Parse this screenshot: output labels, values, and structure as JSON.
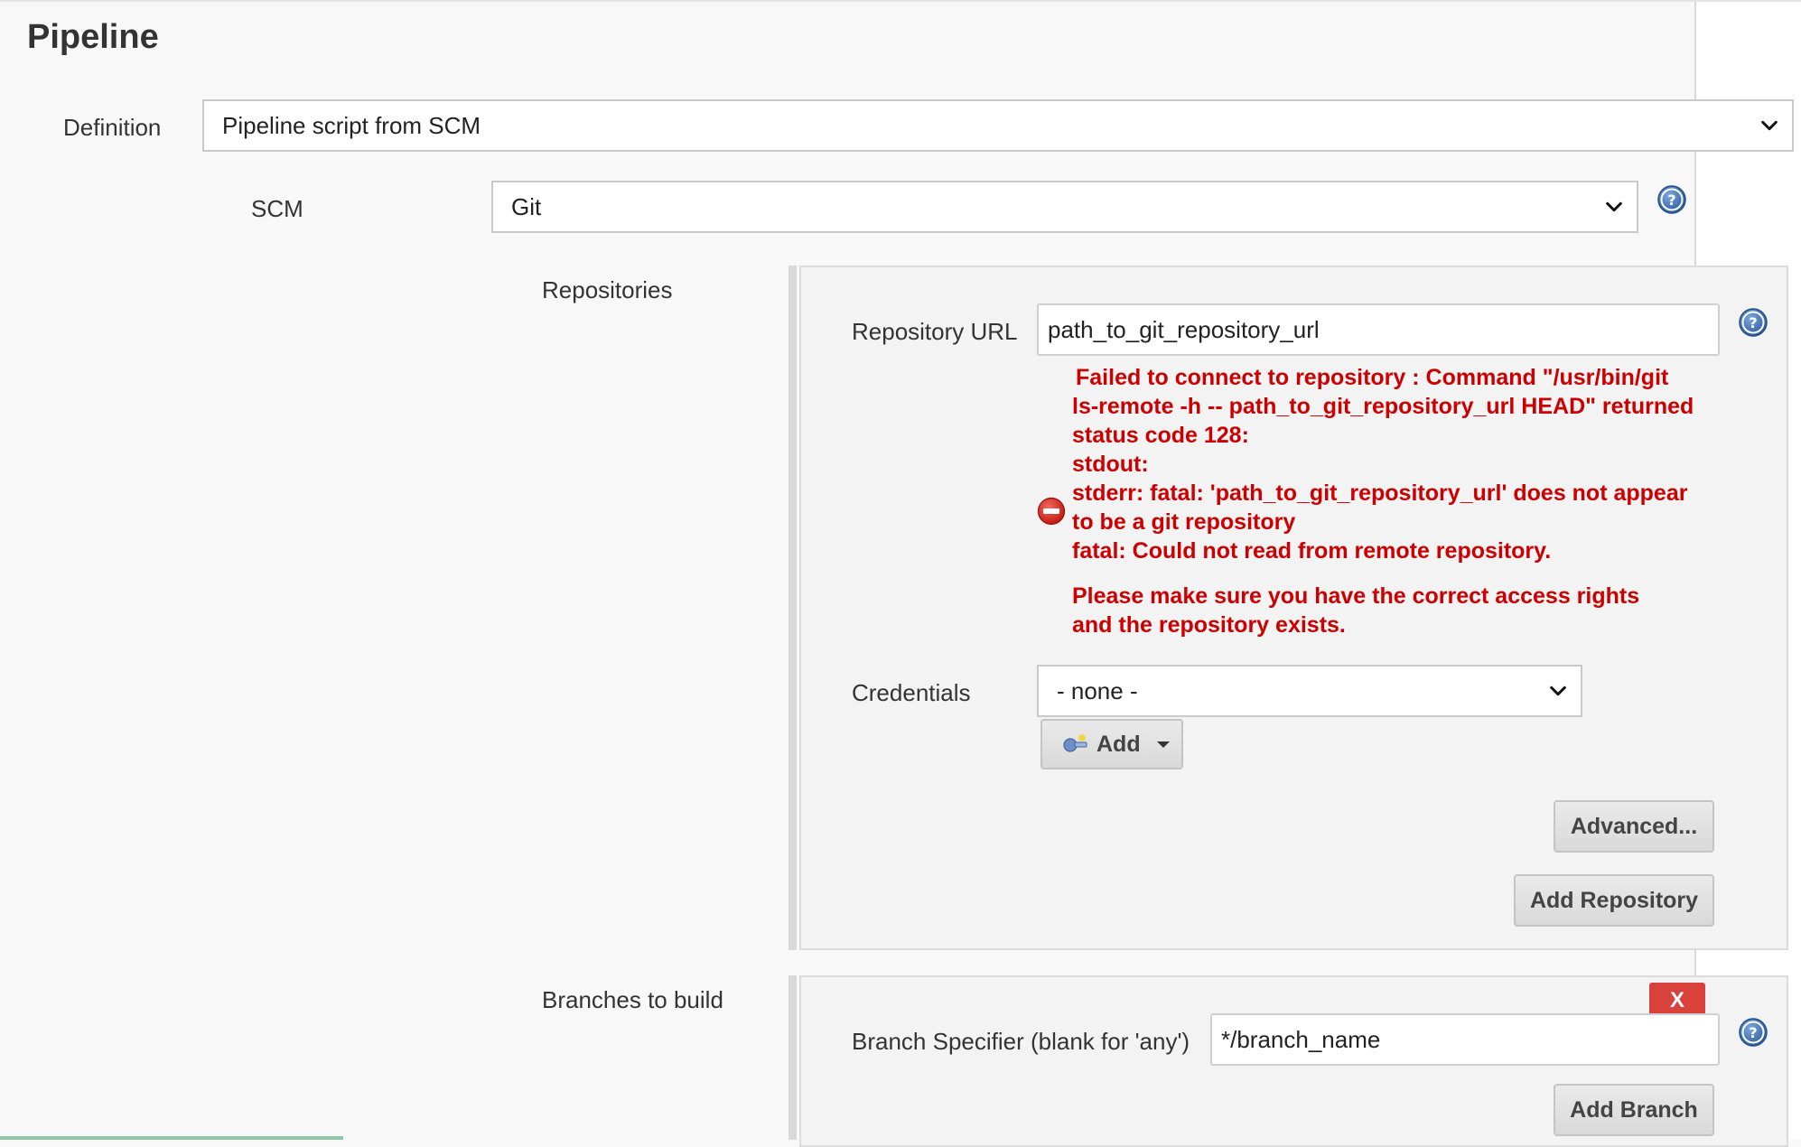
{
  "section": {
    "title": "Pipeline"
  },
  "definition": {
    "label": "Definition",
    "value": "Pipeline script from SCM"
  },
  "scm": {
    "label": "SCM",
    "value": "Git"
  },
  "repositories": {
    "label": "Repositories",
    "url_label": "Repository URL",
    "url_value": "path_to_git_repository_url",
    "error_lines": [
      "Failed to connect to repository : Command \"/usr/bin/git",
      "ls-remote -h -- path_to_git_repository_url HEAD\" returned",
      "status code 128:",
      "stdout:",
      "stderr: fatal: 'path_to_git_repository_url' does not appear",
      "to be a git repository",
      "fatal: Could not read from remote repository.",
      "Please make sure you have the correct access rights",
      "and the repository exists."
    ],
    "credentials_label": "Credentials",
    "credentials_value": "- none -",
    "add_label": "Add",
    "advanced_label": "Advanced...",
    "add_repository_label": "Add Repository"
  },
  "branches": {
    "label": "Branches to build",
    "specifier_label": "Branch Specifier (blank for 'any')",
    "specifier_value": "*/branch_name",
    "delete_label": "X",
    "add_branch_label": "Add Branch"
  },
  "icons": {
    "help": "help-icon",
    "error": "error-icon",
    "key": "key-icon",
    "chevron": "chevron-down-icon"
  },
  "colors": {
    "error": "#cc0000",
    "help_blue": "#3a6fb0",
    "delete_red": "#d9413b"
  }
}
